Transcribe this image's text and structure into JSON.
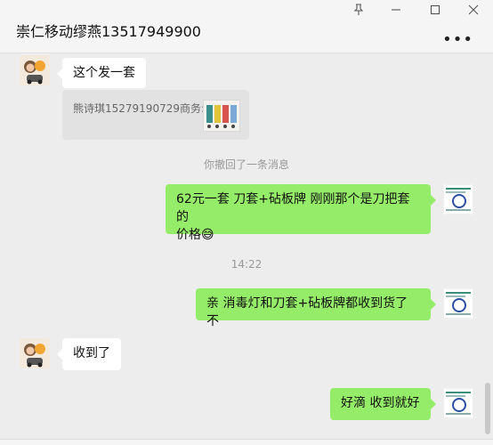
{
  "window": {
    "title": "崇仁移动缪燕13517949900",
    "more_label": "•••",
    "pin_icon": "pin-icon",
    "minimize_icon": "minimize-icon",
    "maximize_icon": "maximize-icon",
    "close_icon": "close-icon"
  },
  "messages": [
    {
      "side": "left",
      "text": "这个发一套"
    },
    {
      "quote": "熊诗琪15279190729商务:"
    },
    {
      "system": "你撤回了一条消息"
    },
    {
      "side": "right",
      "text_line1": "62元一套 刀套+砧板牌 刚刚那个是刀把套的",
      "text_line2": "价格",
      "emoji": "😅"
    },
    {
      "timestamp": "14:22"
    },
    {
      "side": "right",
      "text": "亲 消毒灯和刀套+砧板牌都收到货了不"
    },
    {
      "side": "left",
      "text": "收到了"
    },
    {
      "side": "right",
      "text": "好滴 收到就好"
    }
  ],
  "colors": {
    "self_bubble": "#95ec69",
    "other_bubble": "#ffffff",
    "background": "#ededed"
  }
}
